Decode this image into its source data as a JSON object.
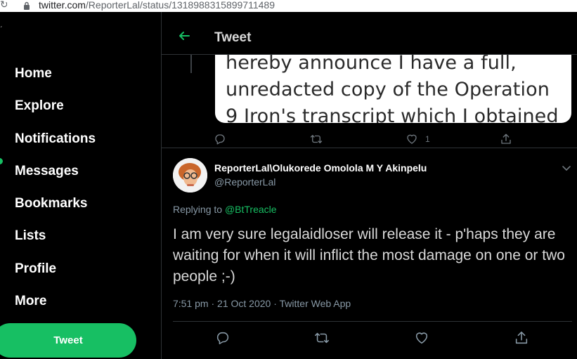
{
  "browser": {
    "url_domain": "twitter.com",
    "url_path": "/ReporterLal/status/1318988315899711489"
  },
  "sidebar": {
    "items": [
      {
        "label": "Home"
      },
      {
        "label": "Explore"
      },
      {
        "label": "Notifications"
      },
      {
        "label": "Messages"
      },
      {
        "label": "Bookmarks"
      },
      {
        "label": "Lists"
      },
      {
        "label": "Profile"
      },
      {
        "label": "More"
      }
    ],
    "tweet_button": "Tweet"
  },
  "header": {
    "title": "Tweet"
  },
  "parent_tweet": {
    "image_text": [
      "hereby announce I have a full,",
      "unredacted copy of the Operation",
      "9 Iron's transcript which I obtained"
    ],
    "like_count": "1"
  },
  "tweet": {
    "author_name": "ReporterLal\\Olukorede Omolola M Y Akinpelu",
    "author_handle": "@ReporterLal",
    "replying_prefix": "Replying to",
    "replying_to": "@BtTreacle",
    "text": "I am very sure legalaidloser will release it - p'haps they are waiting for when it will inflict the most damage on one or two people ;-)",
    "time": "7:51 pm",
    "date": "21 Oct 2020",
    "source": "Twitter Web App",
    "meta_sep": " · "
  },
  "colors": {
    "accent": "#17bf63",
    "background": "#000000",
    "muted": "#8899a6",
    "border": "#2f3336"
  },
  "icons": {
    "back": "arrow-left-icon",
    "reply": "reply-icon",
    "retweet": "retweet-icon",
    "like": "heart-icon",
    "share": "share-icon",
    "caret": "chevron-down-icon",
    "lock": "lock-icon"
  }
}
